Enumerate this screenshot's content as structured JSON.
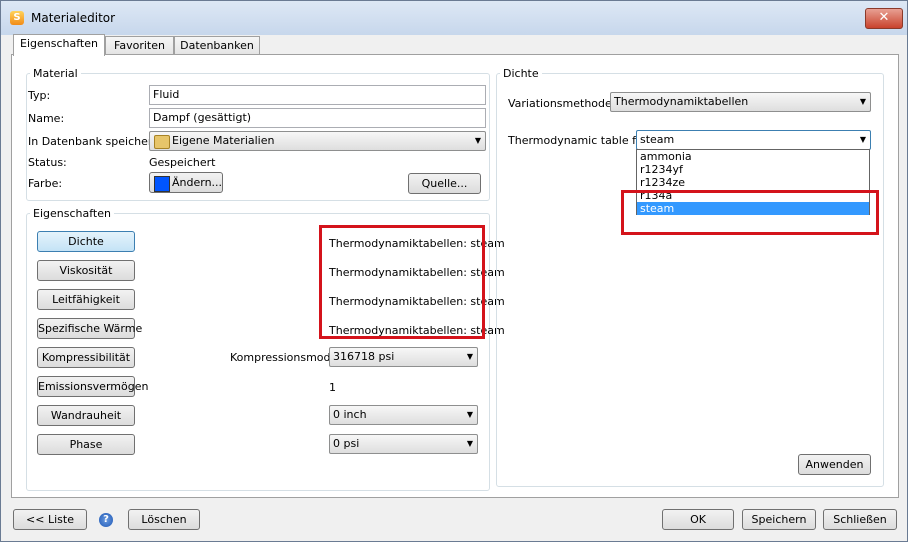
{
  "window": {
    "title": "Materialeditor",
    "close_glyph": "✕"
  },
  "tabs": [
    "Eigenschaften",
    "Favoriten",
    "Datenbanken"
  ],
  "material": {
    "legend": "Material",
    "type_label": "Typ:",
    "type_value": "Fluid",
    "name_label": "Name:",
    "name_value": "Dampf (gesättigt)",
    "db_label": "In Datenbank speichern:",
    "db_value": "Eigene Materialien",
    "status_label": "Status:",
    "status_value": "Gespeichert",
    "color_label": "Farbe:",
    "color_button": "Ändern...",
    "source_button": "Quelle...",
    "swatch_color": "#0055ff"
  },
  "properties": {
    "legend": "Eigenschaften",
    "items": [
      {
        "label": "Dichte",
        "value": "Thermodynamiktabellen: steam"
      },
      {
        "label": "Viskosität",
        "value": "Thermodynamiktabellen: steam"
      },
      {
        "label": "Leitfähigkeit",
        "value": "Thermodynamiktabellen: steam"
      },
      {
        "label": "Spezifische Wärme",
        "value": "Thermodynamiktabellen: steam"
      },
      {
        "label": "Kompressibilität",
        "value_label": "Kompressionsmodul",
        "value": "316718 psi"
      },
      {
        "label": "Emissionsvermögen",
        "value": "1"
      },
      {
        "label": "Wandrauheit",
        "value": "0 inch"
      },
      {
        "label": "Phase",
        "value": "0 psi"
      }
    ]
  },
  "density": {
    "legend": "Dichte",
    "method_label": "Variationsmethode:",
    "method_value": "Thermodynamiktabellen",
    "table_label": "Thermodynamic table file:",
    "table_value": "steam",
    "options": [
      "ammonia",
      "r1234yf",
      "r1234ze",
      "r134a",
      "steam"
    ],
    "apply_button": "Anwenden"
  },
  "footer": {
    "list_button": "<< Liste",
    "help_glyph": "?",
    "delete_button": "Löschen",
    "ok_button": "OK",
    "save_button": "Speichern",
    "close_button": "Schließen"
  },
  "colors": {
    "highlight_box": "#d4131b",
    "selection": "#3399ff"
  }
}
